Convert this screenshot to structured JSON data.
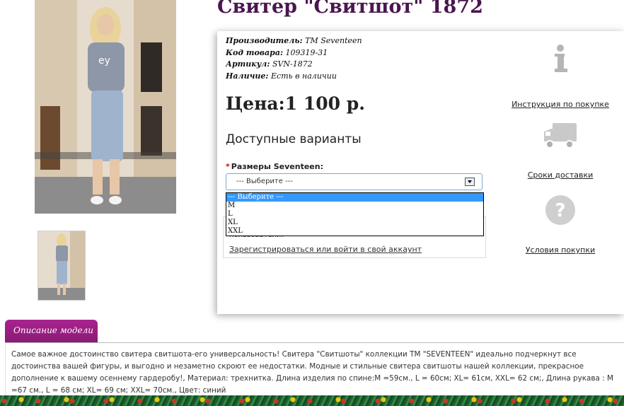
{
  "product": {
    "title": "Свитер \"Свитшот\" 1872",
    "manufacturer_label": "Производитель:",
    "manufacturer": "TM Seventeen",
    "code_label": "Код товара:",
    "code": "109319-31",
    "article_label": "Артикул:",
    "article": "SVN-1872",
    "stock_label": "Наличие:",
    "stock": "Есть в наличии",
    "price": "Цена:1 100 р."
  },
  "options": {
    "title": "Доступные варианты",
    "required_mark": "*",
    "size_label": "Размеры Seventeen:",
    "selected": "--- Выберите ---",
    "list": [
      "--- Выберите ---",
      "M",
      "L",
      "XL",
      "XXL"
    ]
  },
  "login": {
    "message": "пользователи!",
    "link": "Зарегистрироваться или войти в свой аккаунт"
  },
  "side": {
    "instruction": "Инструкция по покупке",
    "delivery": "Сроки доставки",
    "terms": "Условия покупки"
  },
  "description": {
    "tab": "Описание модели",
    "text": "Самое важное достоинство свитера свитшота-его универсальность! Свитера \"Свитшоты\" коллекции ТМ \"SEVENTEEN\" идеально подчеркнут все достоинства вашей фигуры, и выгодно и незаметно скроют ее недостатки. Модные и стильные свитера свитшоты нашей коллекции, прекрасное дополнение к вашему осеннему гардеробу!, Материал: трехнитка. Длина изделия по спине:М =59см., L = 60см; XL= 61см, XXL= 62 см;, Длина рукава : М =67 см., L = 68 см; XL= 69 см; XXL= 70см., Цвет: синий"
  },
  "icons": {
    "info": "info-icon",
    "truck": "truck-icon",
    "question": "question-icon"
  }
}
